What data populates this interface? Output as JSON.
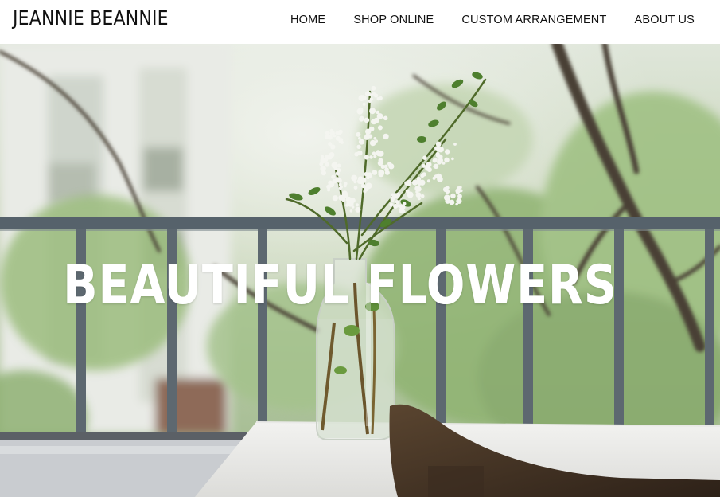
{
  "header": {
    "brand": "JEANNIE BEANNIE",
    "nav": [
      {
        "label": "HOME"
      },
      {
        "label": "SHOP ONLINE"
      },
      {
        "label": "CUSTOM ARRANGEMENT"
      },
      {
        "label": "ABOUT US"
      }
    ]
  },
  "hero": {
    "title": "BEAUTIFUL FLOWERS",
    "image": "flowers-in-glass-vase-on-balcony-table"
  },
  "colors": {
    "header_bg": "#ffffff",
    "text": "#111111",
    "hero_title": "#ffffff",
    "foliage": "#9fbe84",
    "railing": "#55616a"
  }
}
